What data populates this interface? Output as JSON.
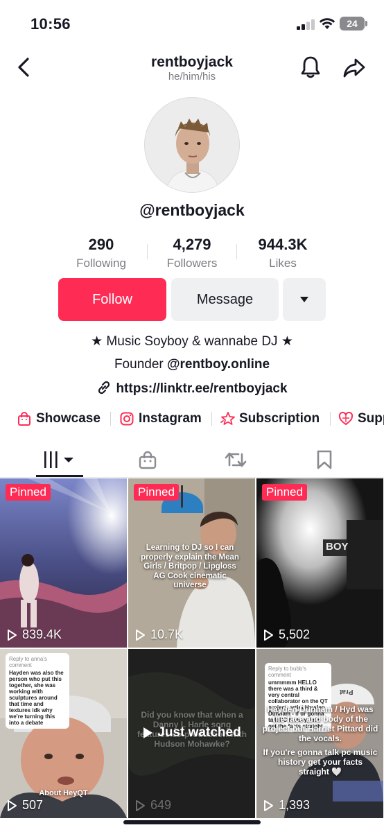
{
  "status_bar": {
    "time": "10:56",
    "battery": "24"
  },
  "header": {
    "username": "rentboyjack",
    "pronouns": "he/him/his"
  },
  "profile": {
    "handle": "@rentboyjack"
  },
  "stats": [
    {
      "value": "290",
      "label": "Following"
    },
    {
      "value": "4,279",
      "label": "Followers"
    },
    {
      "value": "944.3K",
      "label": "Likes"
    }
  ],
  "actions": {
    "follow": "Follow",
    "message": "Message"
  },
  "bio": {
    "line1": "★ Music Soyboy & wannabe DJ ★",
    "founder_prefix": "Founder",
    "founder_handle": "@rentboy.online",
    "link": "https://linktr.ee/rentboyjack"
  },
  "chips": [
    "Showcase",
    "Instagram",
    "Subscription",
    "Supp"
  ],
  "colors": {
    "accent": "#fe2c55",
    "text": "#161823",
    "muted": "#7a7b80"
  },
  "tabs": [
    "videos-grid-icon",
    "shop-bag-icon",
    "repost-icon",
    "bookmark-icon"
  ],
  "grid": {
    "pinned_label": "Pinned",
    "tiles": [
      {
        "views": "839.4K"
      },
      {
        "views": "10.7K",
        "caption": "Learning to DJ so I can properly explain the Mean Girls / Britpop / Lipgloss AG Cook cinematic universe"
      },
      {
        "views": "5,502",
        "sign": "BOY"
      },
      {
        "views": "507",
        "comment_reply": "Reply to anna's comment",
        "comment": "Hayden was also the person who put this together, she was working with sculptures around that time and textures idk why we're turning this into a debate",
        "caption": "About HeyQT"
      },
      {
        "views": "649",
        "caption": "Did you know that when a Danny L Harle song features co-production with Hudson Mohawke?",
        "watched": "Just watched"
      },
      {
        "views": "1,393",
        "comment_reply": "Reply to bubb's comment",
        "comment": "ummmmm HELLO there was a third & very central collaborator on the QT project, artist Hayden Dunham - if ur gonna talk PC history, let's get the facts straight",
        "caption": "Hayden Dunham / Hyd was the face and body of the project but Harriet Pittard did the vocals.",
        "caption2": "If you're gonna talk pc music history get your facts straight 🤍",
        "cap_word": "Prat"
      }
    ]
  }
}
